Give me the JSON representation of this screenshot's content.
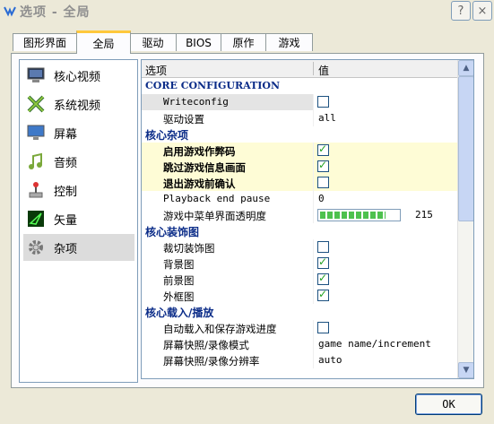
{
  "window": {
    "title": "选项 - 全局"
  },
  "title_buttons": {
    "help": "?",
    "close": "×"
  },
  "tabs": [
    {
      "label": "图形界面",
      "active": false
    },
    {
      "label": "全局",
      "active": true
    },
    {
      "label": "驱动",
      "active": false
    },
    {
      "label": "BIOS",
      "active": false
    },
    {
      "label": "原作",
      "active": false
    },
    {
      "label": "游戏",
      "active": false
    }
  ],
  "sidebar": {
    "items": [
      {
        "label": "核心视频",
        "icon": "monitor-icon",
        "selected": false
      },
      {
        "label": "系统视频",
        "icon": "x-logo-icon",
        "selected": false
      },
      {
        "label": "屏幕",
        "icon": "screen-icon",
        "selected": false
      },
      {
        "label": "音频",
        "icon": "music-note-icon",
        "selected": false
      },
      {
        "label": "控制",
        "icon": "joystick-icon",
        "selected": false
      },
      {
        "label": "矢量",
        "icon": "vector-icon",
        "selected": false
      },
      {
        "label": "杂项",
        "icon": "gear-icon",
        "selected": true
      }
    ]
  },
  "table": {
    "col_option": "选项",
    "col_value": "值",
    "rows": [
      {
        "kind": "category",
        "name": "CORE CONFIGURATION",
        "latin": true
      },
      {
        "kind": "option",
        "name": "Writeconfig",
        "value_type": "checkbox",
        "checked": false,
        "mono": true,
        "selected": true
      },
      {
        "kind": "option",
        "name": "驱动设置",
        "value_type": "text",
        "value": "all"
      },
      {
        "kind": "category",
        "name": "核心杂项"
      },
      {
        "kind": "option",
        "name": "启用游戏作弊码",
        "value_type": "checkbox",
        "checked": true,
        "highlight": true
      },
      {
        "kind": "option",
        "name": "跳过游戏信息画面",
        "value_type": "checkbox",
        "checked": true,
        "highlight": true
      },
      {
        "kind": "option",
        "name": "退出游戏前确认",
        "value_type": "checkbox",
        "checked": false,
        "highlight": true
      },
      {
        "kind": "option",
        "name": "Playback end pause",
        "value_type": "text",
        "value": "0",
        "mono": true
      },
      {
        "kind": "option",
        "name": "游戏中菜单界面透明度",
        "value_type": "slider",
        "value": "215",
        "fraction": 0.84
      },
      {
        "kind": "category",
        "name": "核心装饰图"
      },
      {
        "kind": "option",
        "name": "裁切装饰图",
        "value_type": "checkbox",
        "checked": false
      },
      {
        "kind": "option",
        "name": "背景图",
        "value_type": "checkbox",
        "checked": true
      },
      {
        "kind": "option",
        "name": "前景图",
        "value_type": "checkbox",
        "checked": true
      },
      {
        "kind": "option",
        "name": "外框图",
        "value_type": "checkbox",
        "checked": true
      },
      {
        "kind": "category",
        "name": "核心载入/播放"
      },
      {
        "kind": "option",
        "name": "自动载入和保存游戏进度",
        "value_type": "checkbox",
        "checked": false
      },
      {
        "kind": "option",
        "name": "屏幕快照/录像模式",
        "value_type": "text",
        "value": "game name/increment"
      },
      {
        "kind": "option",
        "name": "屏幕快照/录像分辨率",
        "value_type": "text",
        "value": "auto"
      }
    ]
  },
  "footer": {
    "ok_label": "OK"
  }
}
